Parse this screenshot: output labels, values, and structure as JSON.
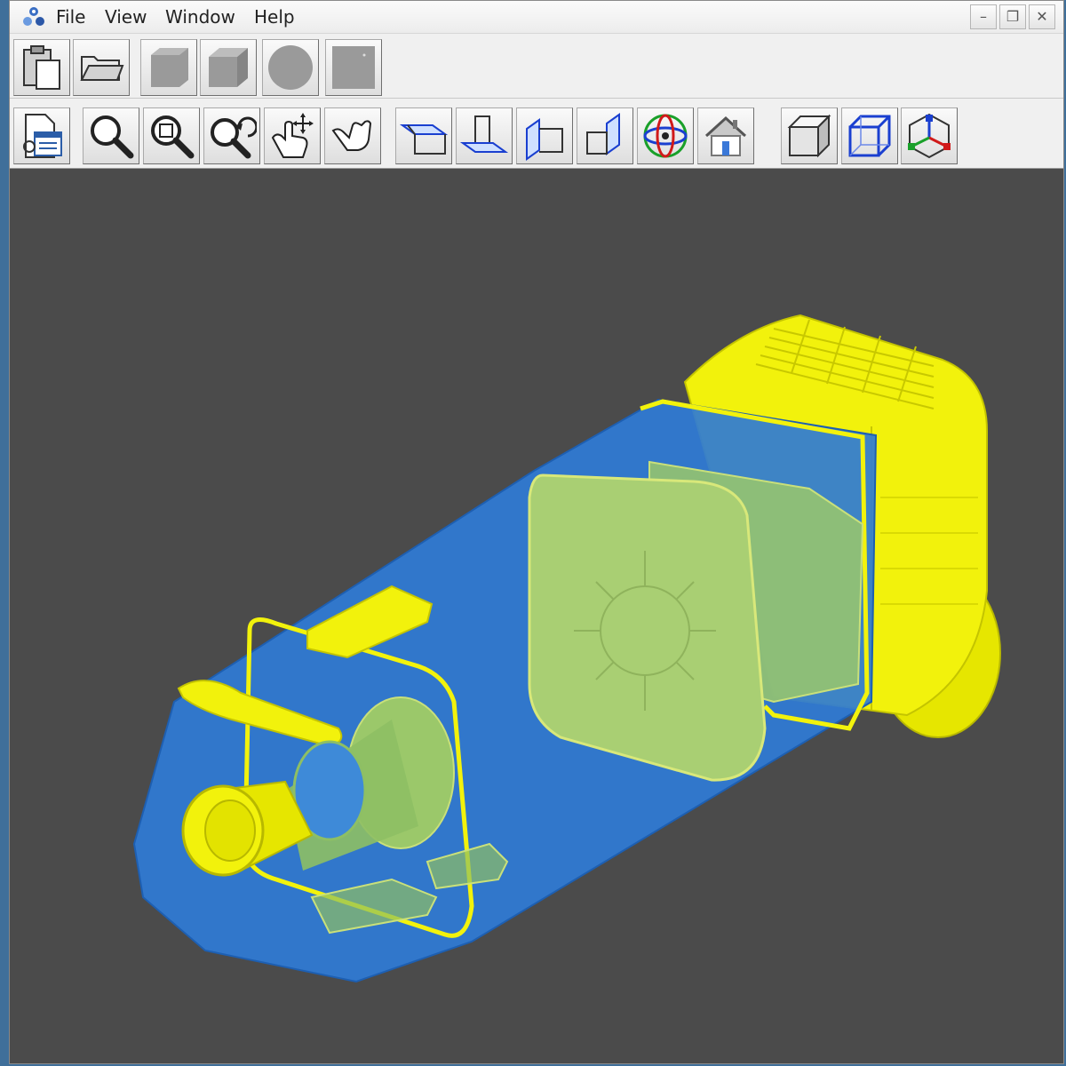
{
  "menubar": {
    "items": [
      {
        "label": "File"
      },
      {
        "label": "View"
      },
      {
        "label": "Window"
      },
      {
        "label": "Help"
      }
    ]
  },
  "window_controls": {
    "minimize": "–",
    "restore": "❐",
    "close": "✕"
  },
  "toolbar_top": {
    "icons": [
      "clipboard-icon",
      "open-folder-icon",
      "box-disabled-icon",
      "cube-disabled-icon",
      "sphere-disabled-icon",
      "plane-disabled-icon"
    ]
  },
  "toolbar_view": {
    "icons": [
      "properties-icon",
      "zoom-icon",
      "zoom-fit-icon",
      "zoom-previous-icon",
      "pan-icon",
      "grab-icon",
      "view-top-icon",
      "view-front-icon",
      "view-side-icon",
      "view-back-icon",
      "orbit-icon",
      "home-icon",
      "shaded-icon",
      "wireframe-icon",
      "axes-icon"
    ]
  },
  "colors": {
    "viewport_bg": "#4b4b4b",
    "part_yellow": "#f2f20c",
    "part_blue": "#2f7bd6"
  }
}
